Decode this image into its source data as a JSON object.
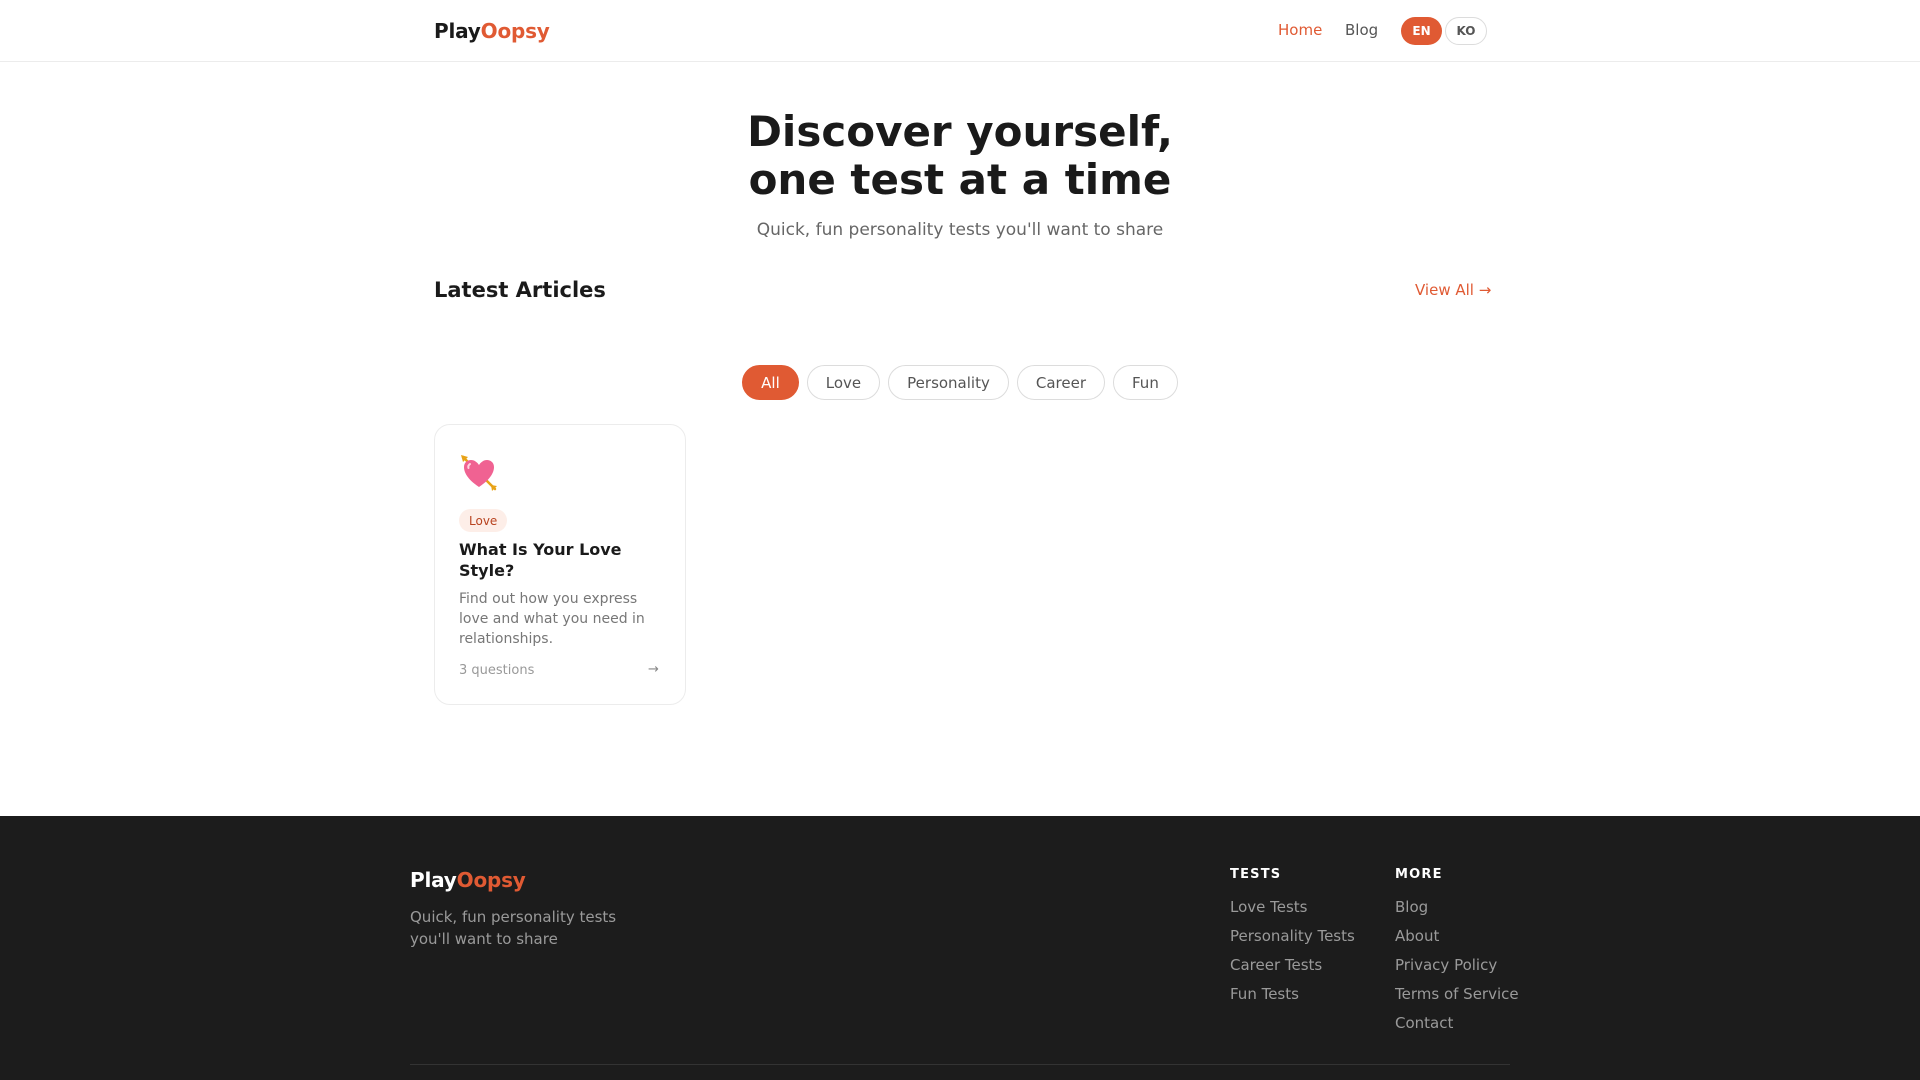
{
  "brand": {
    "part1": "Play",
    "part2": "Oopsy",
    "accent_color": "#e05a33"
  },
  "nav": {
    "home": "Home",
    "blog": "Blog",
    "lang_en": "EN",
    "lang_ko": "KO"
  },
  "hero": {
    "title_line1": "Discover yourself,",
    "title_line2": "one test at a time",
    "subtitle": "Quick, fun personality tests you'll want to share"
  },
  "articles": {
    "title": "Latest Articles",
    "view_all": "View All →"
  },
  "filters": [
    "All",
    "Love",
    "Personality",
    "Career",
    "Fun"
  ],
  "card": {
    "icon": "heart-with-arrow-icon",
    "tag": "Love",
    "title": "What Is Your Love Style?",
    "description": "Find out how you express love and what you need in relationships.",
    "meta": "3 questions",
    "arrow": "→"
  },
  "footer": {
    "tagline": "Quick, fun personality tests you'll want to share",
    "tests_heading": "TESTS",
    "tests_links": [
      "Love Tests",
      "Personality Tests",
      "Career Tests",
      "Fun Tests"
    ],
    "more_heading": "MORE",
    "more_links": [
      "Blog",
      "About",
      "Privacy Policy",
      "Terms of Service",
      "Contact"
    ]
  }
}
